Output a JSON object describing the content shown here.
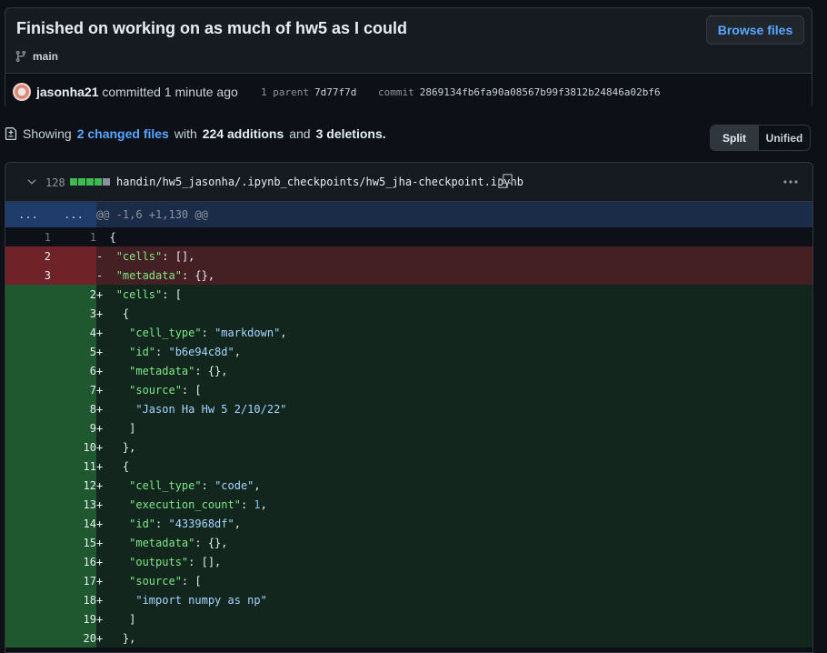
{
  "commit": {
    "title": "Finished on working on as much of hw5 as I could",
    "browse_label": "Browse files",
    "branch": "main",
    "author": "jasonha21",
    "action": "committed",
    "time": "1 minute ago",
    "parent_label": "1 parent",
    "parent_sha": "7d77f7d",
    "commit_label": "commit",
    "commit_sha": "2869134fb6fa90a08567b99f3812b24846a02bf6"
  },
  "summary": {
    "showing": "Showing",
    "changed_files": "2 changed files",
    "with": "with",
    "additions": "224 additions",
    "and": "and",
    "deletions": "3 deletions",
    "period": "."
  },
  "view_toggle": {
    "split": "Split",
    "unified": "Unified",
    "active": "split"
  },
  "file": {
    "change_count": "128",
    "path": "handin/hw5_jasonha/.ipynb_checkpoints/hw5_jha-checkpoint.ipynb",
    "hunk_left": "...",
    "hunk_right": "...",
    "hunk_header": "@@ -1,6 +1,130 @@"
  },
  "colors": {
    "accent": "#58a6ff",
    "addition": "#3fb950",
    "deletion": "#f85149"
  },
  "icons": {
    "branch": "git-branch-icon",
    "diff": "file-diff-icon",
    "chevron": "chevron-down-icon",
    "copy": "copy-icon",
    "more": "kebab-horizontal-icon"
  }
}
